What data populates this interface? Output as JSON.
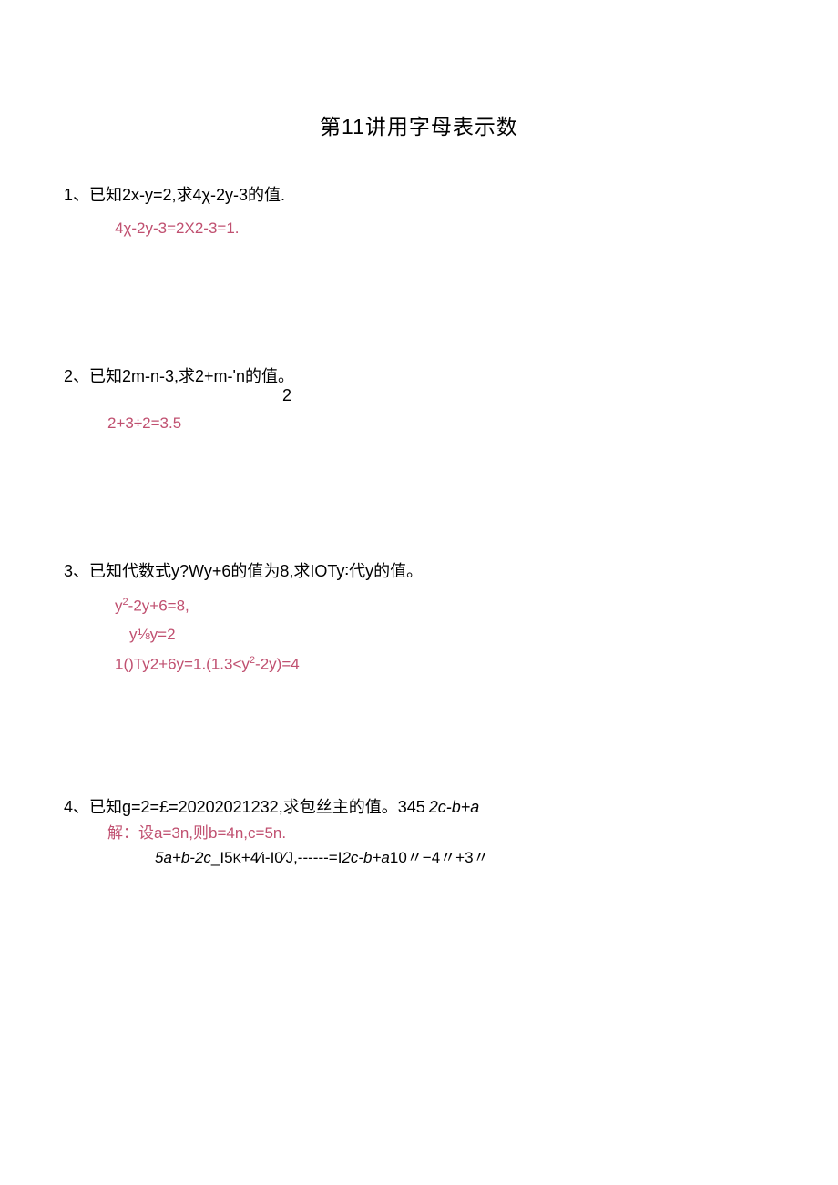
{
  "title": "第11讲用字母表示数",
  "q1": {
    "text": "1、已知2x-y=2,求4χ-2y-3的值.",
    "answer": "4χ-2y-3=2X2-3=1."
  },
  "q2": {
    "text": "2、已知2m-n-3,求2+m-'n的值。",
    "sub": "2",
    "answer": "2+3÷2=3.5"
  },
  "q3": {
    "text": "3、已知代数式y?Wy+6的值为8,求IOTy∶代y的值。",
    "line1_a": "y",
    "line1_b": "-2y+6=8,",
    "line2": "y⅛y=2",
    "line3_a": "1()Ty2+6y=1.(1.3<y",
    "line3_b": "-2y)=4"
  },
  "q4": {
    "text_a": "4、已知g=2=£=20202021232,求包丝主的值。345",
    "text_b": "2c-b+a",
    "sol_prefix": "解：",
    "sol_rest": "设a=3n,则b=4n,c=5n.",
    "last_a": "5a+b-2c",
    "last_b": "_I5",
    "last_c": "K",
    "last_d": "+4∕ι-I0∕J,------=I",
    "last_e": "2c-b+a",
    "last_f": "10〃−4〃+3〃"
  }
}
